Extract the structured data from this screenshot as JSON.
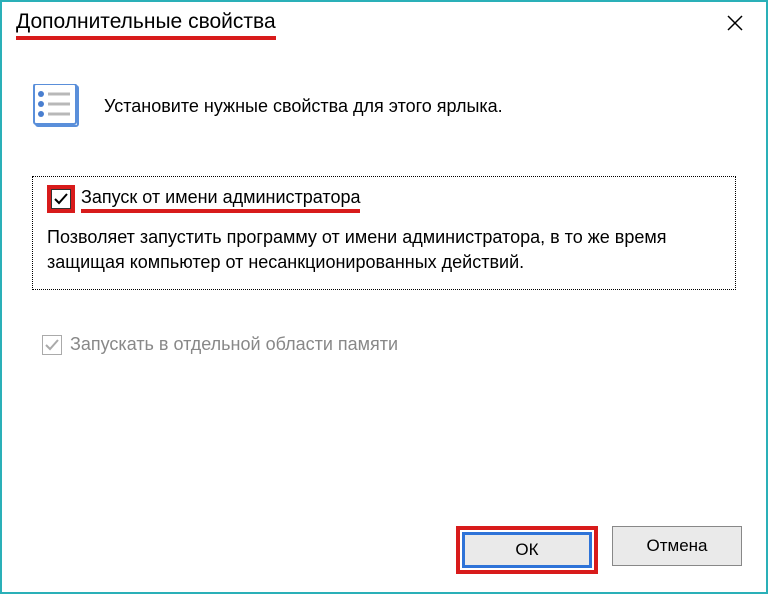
{
  "title": "Дополнительные свойства",
  "instruction": "Установите нужные свойства для этого ярлыка.",
  "option1": {
    "label": "Запуск от имени администратора",
    "checked": true,
    "description": "Позволяет запустить программу от имени администратора, в то же время защищая компьютер от несанкционированных действий."
  },
  "option2": {
    "label": "Запускать в отдельной области памяти",
    "checked": true,
    "disabled": true
  },
  "buttons": {
    "ok": "ОК",
    "cancel": "Отмена"
  }
}
